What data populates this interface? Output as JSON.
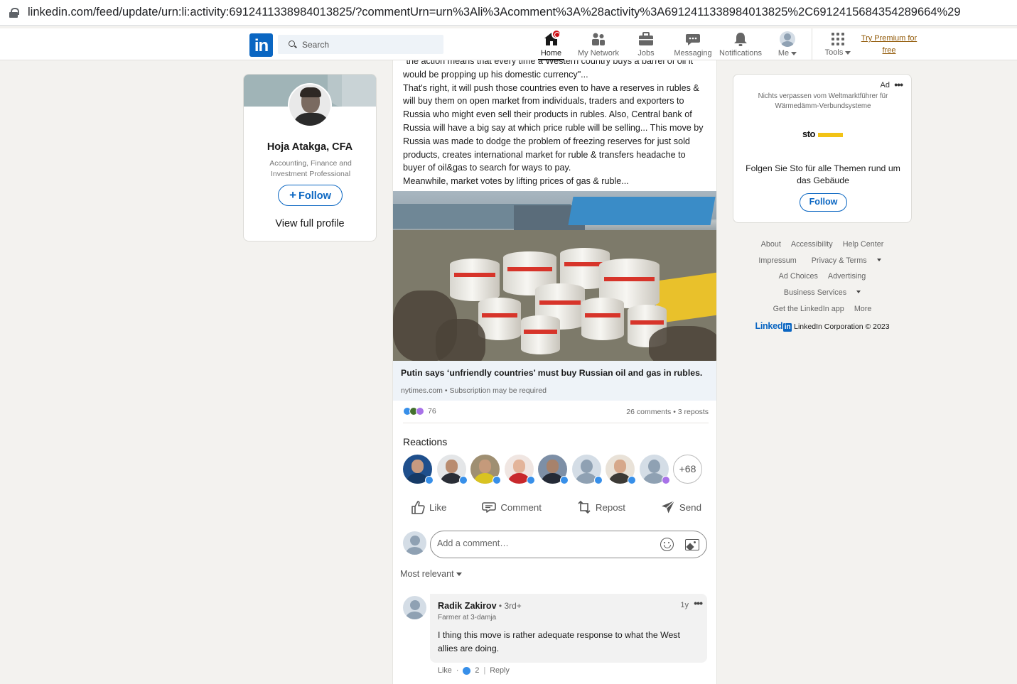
{
  "browser": {
    "url": "linkedin.com/feed/update/urn:li:activity:6912411338984013825/?commentUrn=urn%3Ali%3Acomment%3A%28activity%3A6912411338984013825%2C6912415684354289664%29"
  },
  "nav": {
    "logo": "in",
    "search_placeholder": "Search",
    "items": [
      {
        "label": "Home",
        "icon": "home-icon",
        "active": true
      },
      {
        "label": "My Network",
        "icon": "network-icon"
      },
      {
        "label": "Jobs",
        "icon": "briefcase-icon"
      },
      {
        "label": "Messaging",
        "icon": "message-icon"
      },
      {
        "label": "Notifications",
        "icon": "bell-icon"
      },
      {
        "label": "Me",
        "icon": "avatar"
      },
      {
        "label": "Tools",
        "icon": "grid-icon"
      }
    ],
    "premium": [
      "Try Premium for",
      "free"
    ]
  },
  "profile": {
    "name": "Hoja Atakga, CFA",
    "headline": "Accounting, Finance and Investment Professional",
    "follow": "Follow",
    "view_profile": "View full profile"
  },
  "post": {
    "text": [
      "\"the action means that every time a Western country buys a barrel of oil it would be propping up his domestic currency\"...",
      "That's right, it will push those countries even to have a reserves in rubles & will buy them on open market from individuals, traders and exporters to Russia who might even sell their products in rubles. Also, Central bank of Russia will have a big say at which price ruble will be selling... This move by Russia was made to dodge the problem of freezing reserves for just sold products, creates international market for ruble & transfers headache to buyer of oil&gas to search for ways to pay.",
      "Meanwhile, market votes by lifting prices of gas & ruble..."
    ],
    "link_title": "Putin says ‘unfriendly countries’ must buy Russian oil and gas in rubles.",
    "link_source": "nytimes.com • Subscription may be required",
    "reaction_count": "76",
    "comments_reposts": "26 comments • 3 reposts",
    "reactions_title": "Reactions",
    "more_reactors": "+68",
    "actions": {
      "like": "Like",
      "comment": "Comment",
      "repost": "Repost",
      "send": "Send"
    },
    "comment_placeholder": "Add a comment…",
    "sort": "Most relevant"
  },
  "comment": {
    "author": "Radik Zakirov",
    "degree": " • 3rd+",
    "time": "1y",
    "subtitle": "Farmer at 3-damja",
    "text": "I thing this move is rather adequate response to what the West allies are doing.",
    "like": "Like",
    "like_count": "2",
    "reply": "Reply"
  },
  "ad": {
    "label": "Ad",
    "top": "Nichts verpassen vom Weltmarktführer für Wärmedämm-Verbundsysteme",
    "logo": "sto",
    "text": "Folgen Sie Sto für alle Themen rund um das Gebäude",
    "follow": "Follow"
  },
  "footer": {
    "about": "About",
    "accessibility": "Accessibility",
    "help": "Help Center",
    "impressum": "Impressum",
    "privacy": "Privacy & Terms",
    "adchoices": "Ad Choices",
    "advertising": "Advertising",
    "business": "Business Services",
    "getapp": "Get the LinkedIn app",
    "more": "More",
    "brand_word": "Linked",
    "brand_in": "in",
    "copyright": "LinkedIn Corporation © 2023"
  },
  "colors": {
    "brand": "#0a66c2",
    "background": "#f3f2ef",
    "premium": "#915907",
    "notification": "#cc1016"
  }
}
